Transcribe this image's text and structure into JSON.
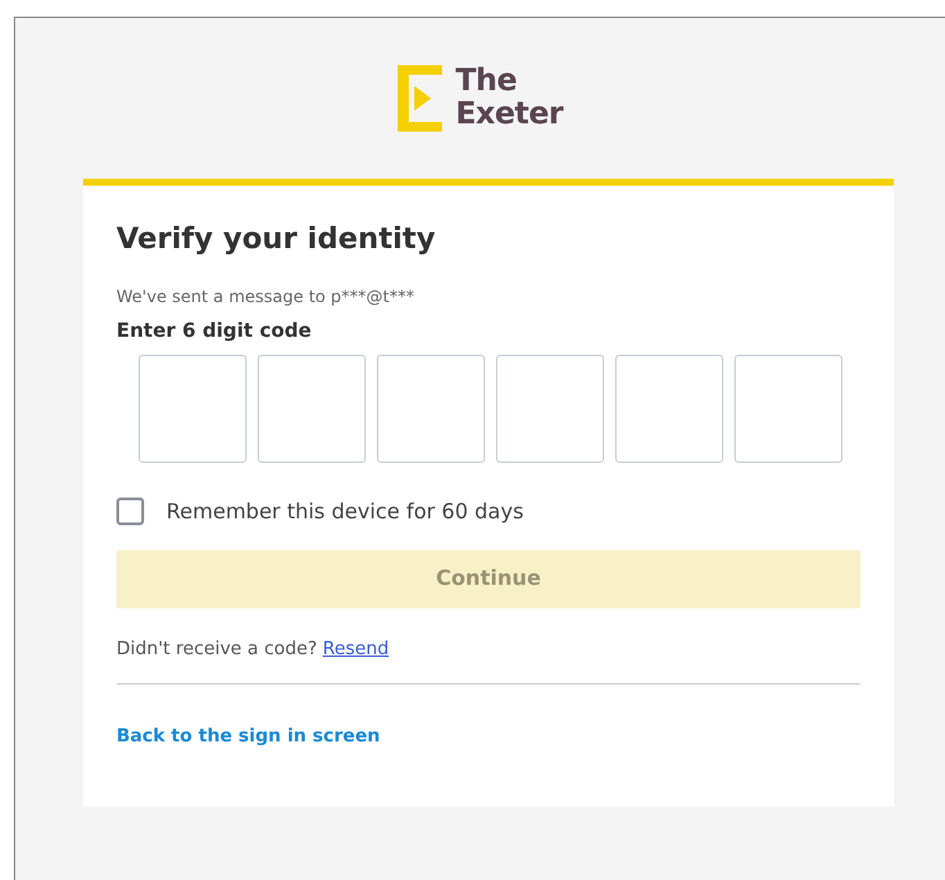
{
  "logo": {
    "line1": "The",
    "line2": "Exeter"
  },
  "title": "Verify your identity",
  "message": "We've sent a message to p***@t***",
  "code_label": "Enter 6 digit code",
  "code_boxes": [
    {
      "filled": false
    },
    {
      "filled": false
    },
    {
      "filled": false
    },
    {
      "filled": false
    },
    {
      "filled": false
    },
    {
      "filled": false
    }
  ],
  "remember": {
    "label": "Remember this device for 60 days",
    "checked": false
  },
  "continue_button": {
    "label": "Continue",
    "disabled": true
  },
  "resend": {
    "prompt": "Didn't receive a code?",
    "link": "Resend"
  },
  "back_link": "Back to the sign in screen"
}
